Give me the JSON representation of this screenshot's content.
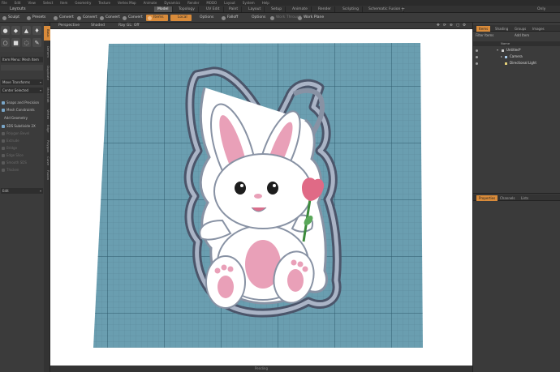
{
  "menubar": {
    "items": [
      "File",
      "Edit",
      "View",
      "Select",
      "Item",
      "Geometry",
      "Texture",
      "Vertex Map",
      "Animate",
      "Dynamics",
      "Render",
      "MODO",
      "Layout",
      "System",
      "Help"
    ]
  },
  "layoutbar": {
    "title": "Layouts",
    "tabs": [
      "Model",
      "Topology",
      "UV Edit",
      "Paint",
      "Layout",
      "Setup",
      "Animate",
      "Render",
      "Scripting",
      "Schematic Fusion"
    ],
    "active_tab": "Model",
    "right_label": "Only"
  },
  "toolbar": {
    "sculpt": "Sculpt",
    "presets": "Presets",
    "convert_buttons": [
      "Convert",
      "Convert",
      "Convert",
      "Convert"
    ],
    "items_label": "Items",
    "local_label": "Local",
    "options1": "Options",
    "falloff": "Falloff",
    "options2": "Options",
    "snap_through": "Work Through",
    "workplane": "Work Plane"
  },
  "left_panel": {
    "item_menu": "Item Menu: Mesh Item",
    "move_transforms": "Move Transforms",
    "center_selected": "Center Selected",
    "rows": [
      {
        "label": "Snaps and Precision",
        "enabled": true
      },
      {
        "label": "Mesh Constraints",
        "enabled": true
      },
      {
        "label": "Add Geometry",
        "enabled": true
      },
      {
        "label": "SDS Subdivide 2X",
        "enabled": true
      },
      {
        "label": "Polygon Bevel",
        "enabled": false
      },
      {
        "label": "Extrude",
        "enabled": false
      },
      {
        "label": "Bridge",
        "enabled": false
      },
      {
        "label": "Edge Slice",
        "enabled": false
      },
      {
        "label": "Smooth SDS",
        "enabled": false
      },
      {
        "label": "Thicken",
        "enabled": false
      }
    ],
    "edit_field": "Edit",
    "side_tabs": [
      "Basic",
      "Deform",
      "Duplicate",
      "Mesh Edit",
      "Vertex",
      "Edge",
      "Polygon",
      "Curve",
      "Fusion"
    ]
  },
  "viewport": {
    "perspective": "Perspective",
    "shading": "Shaded",
    "ray_gl": "Ray GL: Off",
    "status_label": "Pending"
  },
  "right_panel": {
    "tabs": [
      "Items",
      "Shading",
      "Groups",
      "Images"
    ],
    "filter_label": "Filter Items",
    "add_item": "Add Item",
    "col_name": "Name",
    "scene": [
      "Untitled*",
      "Camera",
      "Directional Light"
    ],
    "lower_tabs": [
      "Properties",
      "Channels",
      "Lists"
    ]
  },
  "colors": {
    "accent_orange": "#d98b3a",
    "plate_blue": "#6a9eb0",
    "cutter_gray": "#8892a4",
    "bunny_pink": "#e9a0b8",
    "background_white": "#ffffff"
  }
}
